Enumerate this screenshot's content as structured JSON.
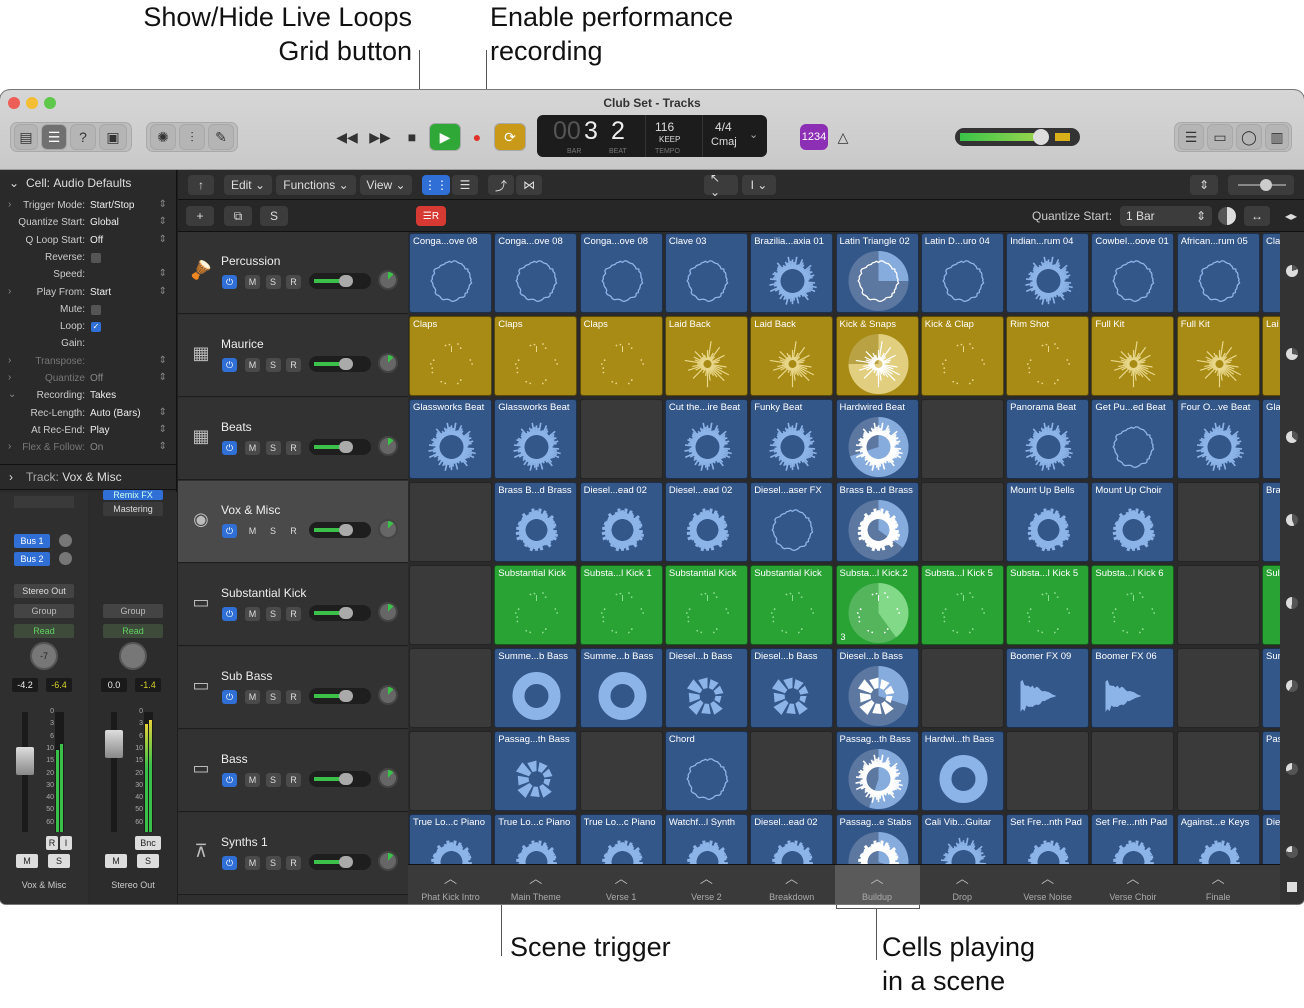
{
  "callouts": {
    "show_hide": [
      "Show/Hide Live Loops",
      "Grid button"
    ],
    "perf": [
      "Enable performance",
      "recording"
    ],
    "scene_trigger": "Scene trigger",
    "cells_playing": [
      "Cells playing",
      "in a scene"
    ]
  },
  "window": {
    "title": "Club Set - Tracks"
  },
  "lcd": {
    "bar_pre": "00",
    "bar": "3",
    "beat": "2",
    "bar_label": "BAR",
    "beat_label": "BEAT",
    "tempo": "116",
    "keep": "KEEP",
    "tempo_label": "TEMPO",
    "sig": "4/4",
    "key": "Cmaj"
  },
  "toolbar": {
    "edit": "Edit",
    "functions": "Functions",
    "view": "View",
    "quantize_label": "Quantize Start:",
    "quantize_value": "1 Bar",
    "count_in": "1234",
    "plus": "+",
    "s": "S"
  },
  "inspector": {
    "cell_header": "Cell:",
    "cell_header_val": "Audio Defaults",
    "rows": [
      {
        "label": "Trigger Mode:",
        "value": "Start/Stop",
        "arrow": true,
        "disc": true
      },
      {
        "label": "Quantize Start:",
        "value": "Global",
        "arrow": true
      },
      {
        "label": "Q Loop Start:",
        "value": "Off",
        "arrow": true
      },
      {
        "label": "Reverse:",
        "check": "off"
      },
      {
        "label": "Speed:",
        "value": "",
        "arrow": true
      },
      {
        "label": "Play From:",
        "value": "Start",
        "arrow": true,
        "disc": true
      },
      {
        "label": "Mute:",
        "check": "off"
      },
      {
        "label": "Loop:",
        "check": "on"
      },
      {
        "label": "Gain:",
        "value": ""
      },
      {
        "label": "Transpose:",
        "value": "",
        "arrow": true,
        "disc": true,
        "dim": true
      },
      {
        "label": "Quantize",
        "value": "Off",
        "arrow": true,
        "disc": true,
        "dim": true
      },
      {
        "label": "Recording:",
        "value": "Takes",
        "disc": true,
        "open": true
      },
      {
        "label": "Rec-Length:",
        "value": "Auto (Bars)",
        "arrow": true
      },
      {
        "label": "At Rec-End:",
        "value": "Play",
        "arrow": true
      },
      {
        "label": "Flex & Follow:",
        "value": "On",
        "arrow": true,
        "disc": true,
        "dim": true
      }
    ],
    "track_header": "Track:",
    "track_header_val": "Vox & Misc"
  },
  "strips": [
    {
      "name": "Vox & Misc",
      "sends": [
        "Bus 1",
        "Bus 2"
      ],
      "output": "Stereo Out",
      "group": "Group",
      "auto": "Read",
      "knob": "-7",
      "val1": "-4.2",
      "val2": "-6.4",
      "ri": [
        "R",
        "I"
      ],
      "m": "M",
      "s": "S"
    },
    {
      "name": "Stereo Out",
      "insert1": "Remix FX",
      "insert2": "Mastering",
      "group": "Group",
      "auto": "Read",
      "val1": "0.0",
      "val2": "-1.4",
      "bnc": "Bnc",
      "m": "M",
      "s": "S"
    }
  ],
  "fader_scale": [
    "0",
    "3",
    "6",
    "10",
    "15",
    "20",
    "30",
    "40",
    "50",
    "60"
  ],
  "tracks": [
    {
      "name": "Percussion",
      "icon": "percussion-icon",
      "glyph": "🪘"
    },
    {
      "name": "Maurice",
      "icon": "drum-machine-icon",
      "glyph": "▦"
    },
    {
      "name": "Beats",
      "icon": "drum-machine-icon",
      "glyph": "▦"
    },
    {
      "name": "Vox & Misc",
      "icon": "turntable-icon",
      "glyph": "◉"
    },
    {
      "name": "Substantial Kick",
      "icon": "synth-icon",
      "glyph": "▭"
    },
    {
      "name": "Sub Bass",
      "icon": "synth-icon",
      "glyph": "▭"
    },
    {
      "name": "Bass",
      "icon": "synth-icon",
      "glyph": "▭"
    },
    {
      "name": "Synths 1",
      "icon": "keyboard-stand-icon",
      "glyph": "⊼"
    }
  ],
  "track_buttons": [
    "M",
    "S",
    "R"
  ],
  "colors": {
    "blue": "#34578a",
    "gold": "#a88b14",
    "green": "#2aa335",
    "blue_hl": "#8db4e8",
    "gold_hl": "#e8d68a",
    "green_hl": "#8be08f"
  },
  "rows": [
    {
      "color": "blue",
      "cells": [
        [
          "Conga...ove 08",
          "ring"
        ],
        [
          "Conga...ove 08",
          "ring"
        ],
        [
          "Conga...ove 08",
          "ring"
        ],
        [
          "Clave 03",
          "ring"
        ],
        [
          "Brazilia...axia 01",
          "spiky"
        ],
        [
          "Latin Triangle 02",
          "ring",
          0.25
        ],
        [
          "Latin D...uro 04",
          "ring"
        ],
        [
          "Indian...rum 04",
          "spiky"
        ],
        [
          "Cowbel...oove 01",
          "ring"
        ],
        [
          "African...rum 05",
          "ring"
        ],
        [
          "Cla",
          "ring"
        ]
      ]
    },
    {
      "color": "gold",
      "cells": [
        [
          "Claps",
          "dots"
        ],
        [
          "Claps",
          "dots"
        ],
        [
          "Claps",
          "dots"
        ],
        [
          "Laid Back",
          "burst"
        ],
        [
          "Laid Back",
          "burst"
        ],
        [
          "Kick & Snaps",
          "burst",
          0.75
        ],
        [
          "Kick & Clap",
          "dots"
        ],
        [
          "Rim Shot",
          "dots"
        ],
        [
          "Full Kit",
          "burst"
        ],
        [
          "Full Kit",
          "burst"
        ],
        [
          "Lai",
          "burst"
        ]
      ]
    },
    {
      "color": "blue",
      "cells": [
        [
          "Glassworks Beat",
          "spiky"
        ],
        [
          "Glassworks Beat",
          "spiky"
        ],
        null,
        [
          "Cut the...ire Beat",
          "spiky"
        ],
        [
          "Funky Beat",
          "spiky"
        ],
        [
          "Hardwired Beat",
          "spiky",
          0.7
        ],
        null,
        [
          "Panorama Beat",
          "spiky"
        ],
        [
          "Get Pu...ed Beat",
          "ring"
        ],
        [
          "Four O...ve Beat",
          "spiky"
        ],
        [
          "Gla",
          "spiky"
        ]
      ]
    },
    {
      "color": "blue",
      "cells": [
        null,
        [
          "Brass B...d Brass",
          "thick"
        ],
        [
          "Diesel...ead 02",
          "thick"
        ],
        [
          "Diesel...ead 02",
          "thick"
        ],
        [
          "Diesel...aser FX",
          "ring"
        ],
        [
          "Brass B...d Brass",
          "thick",
          0.35
        ],
        null,
        [
          "Mount Up Bells",
          "thick"
        ],
        [
          "Mount Up Choir",
          "thick"
        ],
        null,
        [
          "Bra",
          "thick"
        ]
      ]
    },
    {
      "color": "green",
      "cells": [
        null,
        [
          "Substantial Kick",
          "dots"
        ],
        [
          "Substa...l Kick 1",
          "dots"
        ],
        [
          "Substantial Kick",
          "dots"
        ],
        [
          "Substantial Kick",
          "dots"
        ],
        [
          "Substa...l Kick.2",
          "dots",
          0.4,
          "3"
        ],
        [
          "Substa...l Kick 5",
          "dots"
        ],
        [
          "Substa...l Kick 5",
          "dots"
        ],
        [
          "Substa...l Kick 6",
          "dots"
        ],
        null,
        [
          "Sul",
          "dots"
        ]
      ]
    },
    {
      "color": "blue",
      "cells": [
        null,
        [
          "Summe...b Bass",
          "donut"
        ],
        [
          "Summe...b Bass",
          "donut"
        ],
        [
          "Diesel...b Bass",
          "chunk"
        ],
        [
          "Diesel...b Bass",
          "chunk"
        ],
        [
          "Diesel...b Bass",
          "chunk",
          0.3
        ],
        null,
        [
          "Boomer FX 09",
          "wave"
        ],
        [
          "Boomer FX 06",
          "wave"
        ],
        null,
        [
          "Sur",
          "donut"
        ]
      ]
    },
    {
      "color": "blue",
      "cells": [
        null,
        [
          "Passag...th Bass",
          "chunk"
        ],
        null,
        [
          "Chord",
          "ring"
        ],
        null,
        [
          "Passag...th Bass",
          "spiky",
          0.55
        ],
        [
          "Hardwi...th Bass",
          "donut"
        ],
        null,
        null,
        null,
        [
          "Pas",
          "chunk"
        ]
      ]
    },
    {
      "color": "blue",
      "cells": [
        [
          "True Lo...c Piano",
          "thick"
        ],
        [
          "True Lo...c Piano",
          "thick"
        ],
        [
          "True Lo...c Piano",
          "thick"
        ],
        [
          "Watchf...l Synth",
          "thick"
        ],
        [
          "Diesel...ead 02",
          "thick"
        ],
        [
          "Passag...e Stabs",
          "thick",
          0.3
        ],
        [
          "Cali Vib...Guitar",
          "spiky"
        ],
        [
          "Set Fre...nth Pad",
          "thick"
        ],
        [
          "Set Fre...nth Pad",
          "thick"
        ],
        [
          "Against...e Keys",
          "thick"
        ],
        [
          "Die",
          "thick"
        ]
      ]
    }
  ],
  "scenes": [
    "Phat Kick Intro",
    "Main Theme",
    "Verse 1",
    "Verse 2",
    "Breakdown",
    "Buildup",
    "Drop",
    "Verse Noise",
    "Verse Choir",
    "Finale"
  ]
}
